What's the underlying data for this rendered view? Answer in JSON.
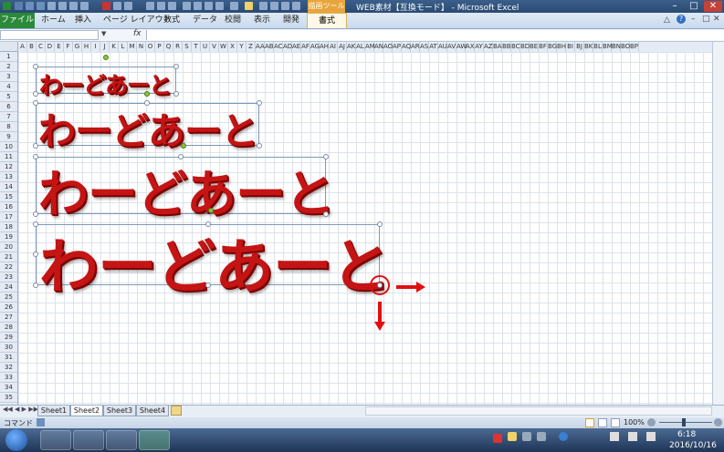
{
  "window": {
    "title": "WEB素材【互換モード】 - Microsoft Excel",
    "context_tab": "描画ツール"
  },
  "ribbon": {
    "file_label": "ファイル",
    "tabs": [
      "ホーム",
      "挿入",
      "ページ レイアウト",
      "数式",
      "データ",
      "校閲",
      "表示",
      "開発"
    ],
    "active_tab": "書式"
  },
  "formula_bar": {
    "fx_label": "fx",
    "value": ""
  },
  "grid": {
    "columns": [
      "A",
      "B",
      "C",
      "D",
      "E",
      "F",
      "G",
      "H",
      "I",
      "J",
      "K",
      "L",
      "M",
      "N",
      "O",
      "P",
      "Q",
      "R",
      "S",
      "T",
      "U",
      "V",
      "W",
      "X",
      "Y",
      "Z",
      "AA",
      "AB",
      "AC",
      "AD",
      "AE",
      "AF",
      "AG",
      "AH",
      "AI",
      "AJ",
      "AK",
      "AL",
      "AM",
      "AN",
      "AO",
      "AP",
      "AQ",
      "AR",
      "AS",
      "AT",
      "AU",
      "AV",
      "AW",
      "AX",
      "AY",
      "AZ",
      "BA",
      "BB",
      "BC",
      "BD",
      "BE",
      "BF",
      "BG",
      "BH",
      "BI",
      "BJ",
      "BK",
      "BL",
      "BM",
      "BN",
      "BO",
      "BP"
    ],
    "rows": [
      "1",
      "2",
      "3",
      "4",
      "5",
      "6",
      "7",
      "8",
      "9",
      "10",
      "11",
      "12",
      "13",
      "14",
      "15",
      "16",
      "17",
      "18",
      "19",
      "20",
      "21",
      "22",
      "23",
      "24",
      "25",
      "26",
      "27",
      "28",
      "29",
      "30",
      "31",
      "32",
      "33",
      "34",
      "35"
    ]
  },
  "wordart": {
    "text1": "わーどあーと",
    "text2": "わーどあーと",
    "text3": "わーどあーと",
    "text4": "わーどあーと",
    "color": "#c41414"
  },
  "sheets": [
    "Sheet1",
    "Sheet2",
    "Sheet3",
    "Sheet4"
  ],
  "active_sheet": "Sheet2",
  "status": {
    "mode": "コマンド",
    "zoom": "100%"
  },
  "taskbar": {
    "time": "6:18",
    "date": "2016/10/16"
  },
  "annotation": {
    "arrow_color": "#e01010"
  }
}
